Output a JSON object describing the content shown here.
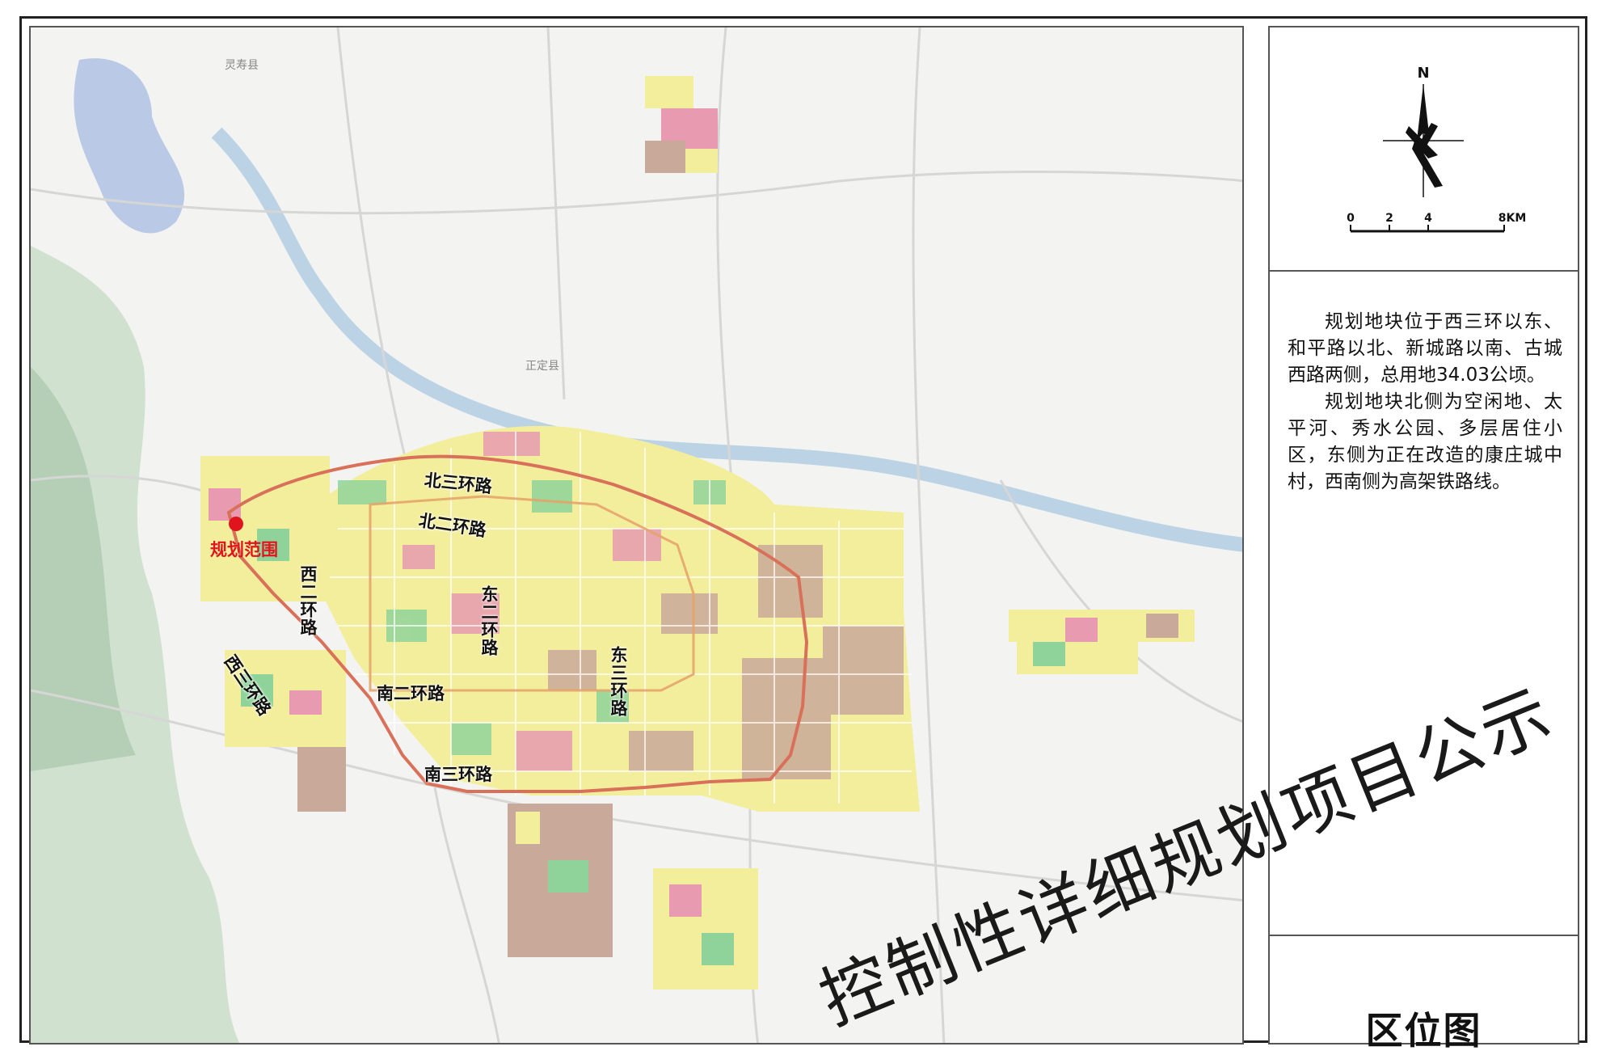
{
  "map": {
    "roads": {
      "north_third": "北三环路",
      "north_second": "北二环路",
      "west_second": "西二环路",
      "east_second": "东二环路",
      "west_third": "西三环路",
      "south_second": "南二环路",
      "east_third": "东三环路",
      "south_third": "南三环路"
    },
    "site_label": "规划范围",
    "towns": {
      "lingshou": "灵寿县",
      "zhengding": "正定县"
    },
    "colors": {
      "ring_road": "#d9705a",
      "site_marker": "#e0141e",
      "residential": "#f3ee9c",
      "commercial": "#e79ab0",
      "industrial": "#c9a99a",
      "green": "#8fd39a"
    }
  },
  "north_arrow": {
    "label": "N"
  },
  "scale_bar": {
    "ticks": [
      "0",
      "2",
      "4",
      "8KM"
    ]
  },
  "description": {
    "p1": "规划地块位于西三环以东、和平路以北、新城路以南、古城西路两侧，总用地34.03公顷。",
    "p2": "规划地块北侧为空闲地、太平河、秀水公园、多层居住小区，东侧为正在改造的康庄城中村，西南侧为高架铁路线。"
  },
  "side_title": "区位图",
  "watermark": "控制性详细规划项目公示"
}
